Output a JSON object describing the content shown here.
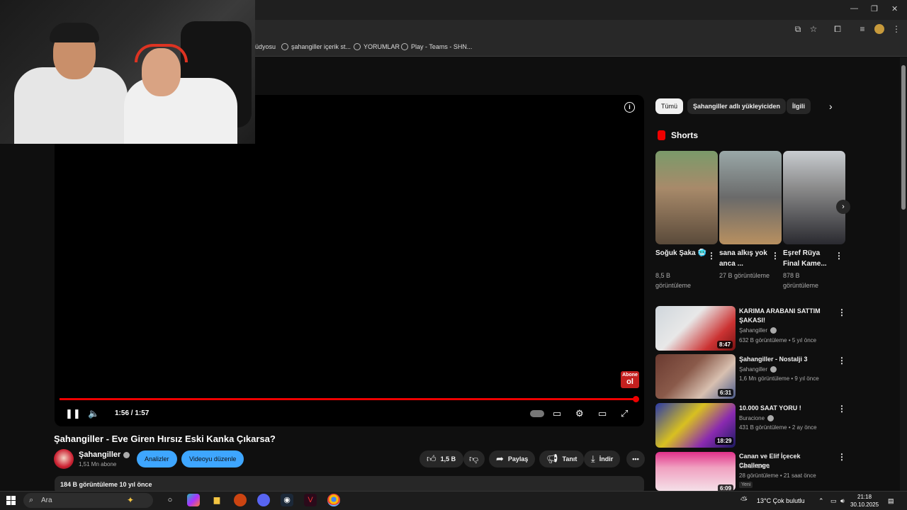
{
  "bookmarks": [
    {
      "label": "üdyosu"
    },
    {
      "label": "şahangiller içerik st..."
    },
    {
      "label": "YORUMLAR"
    },
    {
      "label": "Play - Teams - SHN..."
    }
  ],
  "player": {
    "time": "1:56 / 1:57",
    "progress_fraction": 0.99,
    "abone_line1": "Abone",
    "abone_line2": "ol"
  },
  "video": {
    "title": "Şahangiller - Eve Giren Hırsız Eski Kanka Çıkarsa?",
    "channel_name": "Şahangiller",
    "subscribers": "1,51 Mn abone",
    "analytics_label": "Analizler",
    "edit_label": "Videoyu düzenle",
    "likes": "1,5 B",
    "share_label": "Paylaş",
    "promote_label": "Tanıt",
    "download_label": "İndir",
    "description_summary": "184 B görüntüleme  10 yıl önce"
  },
  "chips": [
    "Tümü",
    "Şahangiller adlı yükleyiciden",
    "İlgili"
  ],
  "shorts": {
    "heading": "Shorts",
    "items": [
      {
        "title": "Soğuk Şaka 🥶",
        "views": "8,5 B görüntüleme"
      },
      {
        "title": "sana alkış yok anca ...",
        "views": "27 B görüntüleme"
      },
      {
        "title": "Eşref Rüya Final Kame...",
        "views": "878 B görüntüleme"
      }
    ]
  },
  "recommended": [
    {
      "title": "KARIMA ARABANI SATTIM ŞAKASI!",
      "channel": "Şahangiller",
      "meta": "632 B görüntüleme • 5 yıl önce",
      "duration": "8:47"
    },
    {
      "title": "Şahangiller - Nostalji 3",
      "channel": "Şahangiller",
      "meta": "1,6 Mn görüntüleme • 9 yıl önce",
      "duration": "6:31"
    },
    {
      "title": "10.000 SAAT YORU !",
      "channel": "Buracione",
      "meta": "431 B görüntüleme • 2 ay önce",
      "duration": "18:29"
    },
    {
      "title": "Canan ve Elif İçecek Challenge",
      "channel": "Canan Duru",
      "meta": "28 görüntüleme • 21 saat önce",
      "duration": "6:09",
      "badge": "Yeni"
    }
  ],
  "taskbar": {
    "search_placeholder": "Ara",
    "weather": "13°C  Çok bulutlu",
    "time": "21:18",
    "date": "30.10.2025"
  },
  "colors": {
    "accent": "#ff0000",
    "blue_button": "#3ea6ff",
    "background": "#0f0f0f"
  }
}
